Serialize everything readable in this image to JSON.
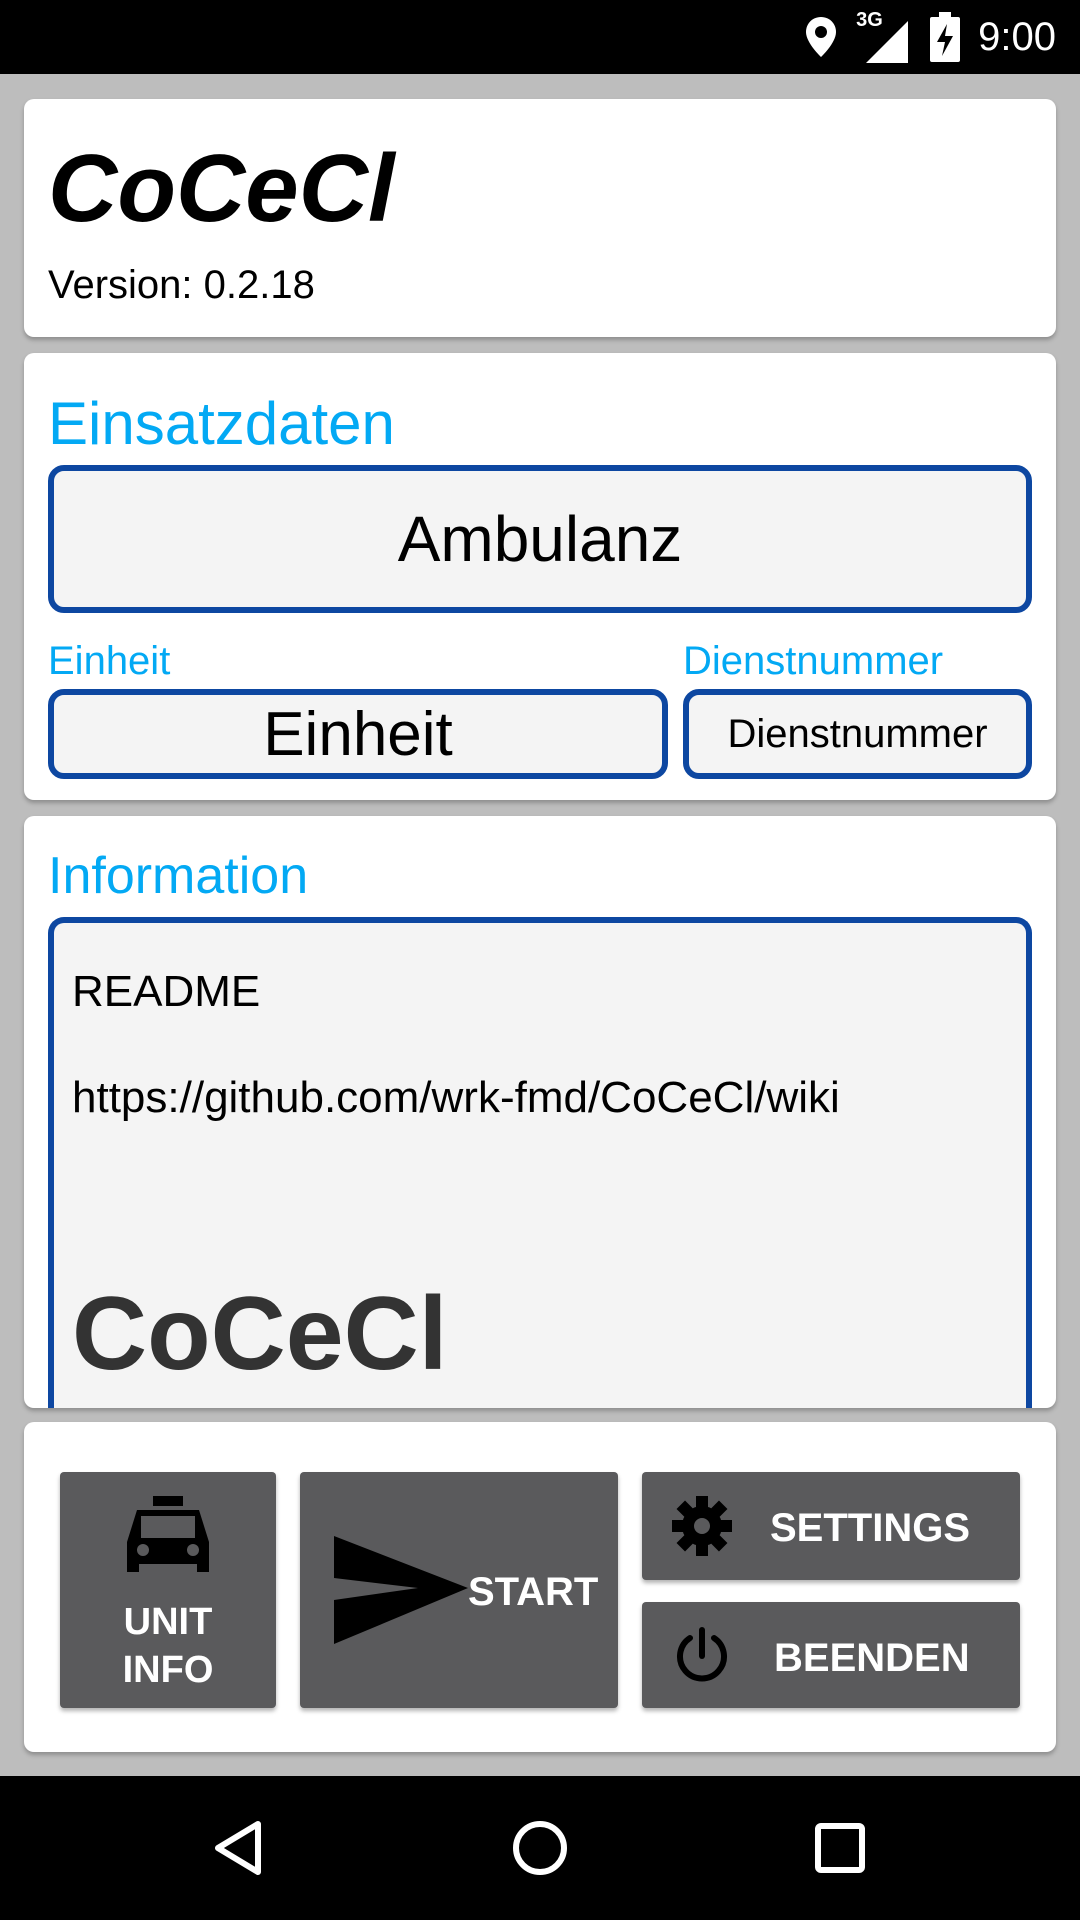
{
  "status_bar": {
    "network": "3G",
    "time": "9:00",
    "icons": [
      "location-icon",
      "signal-icon",
      "battery-charging-icon"
    ]
  },
  "header": {
    "app_title": "CoCeCl",
    "version": "Version: 0.2.18"
  },
  "einsatzdaten": {
    "heading": "Einsatzdaten",
    "mission_button": "Ambulanz",
    "unit_label": "Einheit",
    "unit_value": "Einheit",
    "service_label": "Dienstnummer",
    "service_value": "Dienstnummer"
  },
  "information": {
    "heading": "Information",
    "line1": "README",
    "line2": "https://github.com/wrk-fmd/CoCeCl/wiki",
    "big_title": "CoCeCl"
  },
  "actions": {
    "unit_info_label": "UNIT INFO",
    "start_label": "START",
    "settings_label": "SETTINGS",
    "exit_label": "BEENDEN",
    "icons": [
      "taxi-icon",
      "send-icon",
      "gear-icon",
      "power-icon"
    ]
  },
  "nav_bar": {
    "icons": [
      "back-icon",
      "home-icon",
      "recents-icon"
    ]
  },
  "colors": {
    "accent": "#03a9f4",
    "border": "#0d47a1",
    "button_bg": "#5a5a5c",
    "page_bg": "#bdbdbd"
  }
}
